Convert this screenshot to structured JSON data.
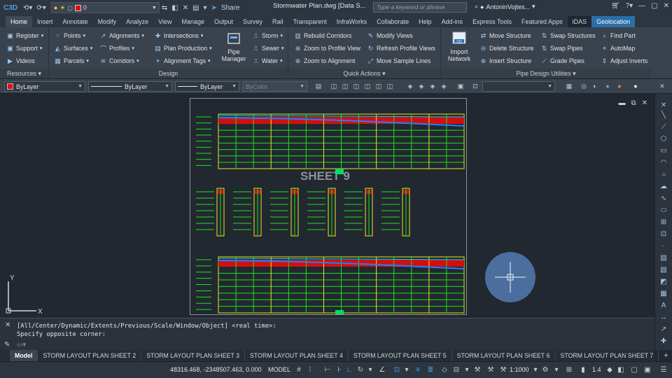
{
  "app": {
    "logo": "C3D",
    "document_title": "Stormwater Plan.dwg [Data S...",
    "search_placeholder": "Type a keyword or phrase",
    "user": "AntoninVojtes...",
    "share": "Share",
    "current_layer": "0"
  },
  "tabs": [
    "Home",
    "Insert",
    "Annotate",
    "Modify",
    "Analyze",
    "View",
    "Manage",
    "Output",
    "Survey",
    "Rail",
    "Transparent",
    "InfraWorks",
    "Collaborate",
    "Help",
    "Add-ins",
    "Express Tools",
    "Featured Apps",
    "iDAS",
    "Geolocation"
  ],
  "ribbon": {
    "left_col": [
      "Register",
      "Support",
      "Videos"
    ],
    "resources_title": "Resources",
    "design_col1": [
      "Points",
      "Surfaces",
      "Parcels"
    ],
    "design_col2": [
      "Alignments",
      "Profiles",
      "Corridors"
    ],
    "design_col3": [
      "Intersections",
      "Plan Production",
      "Alignment Tags"
    ],
    "pipe_manager": [
      "Pipe",
      "Manager"
    ],
    "design_col4": [
      "Storm",
      "Sewer",
      "Water"
    ],
    "design_title": "Design",
    "qa_col1": [
      "Rebuild Corridors",
      "Zoom to Profile View",
      "Zoom to Alignment"
    ],
    "qa_col2": [
      "Modify Views",
      "Refresh Profile Views",
      "Move Sample Lines"
    ],
    "quick_actions_title": "Quick Actions",
    "import_network": [
      "Import",
      "Network"
    ],
    "pdu_col1": [
      "Move Structure",
      "Delete Structure",
      "Insert Structure"
    ],
    "pdu_col2": [
      "Swap Structures",
      "Swap Pipes",
      "Grade Pipes"
    ],
    "pdu_col3": [
      "Find Part",
      "AutoMap",
      "Adjust Inverts"
    ],
    "pipe_design_title": "Pipe Design Utilities"
  },
  "properties": {
    "color": "ByLayer",
    "linetype": "ByLayer",
    "lineweight": "ByLayer",
    "plotstyle": "ByColor",
    "view_combo": ""
  },
  "drawing": {
    "sheet_label": "SHEET 9"
  },
  "command": {
    "line1": "[All/Center/Dynamic/Extents/Previous/Scale/Window/Object] <real time>:",
    "line2": "Specify opposite corner:"
  },
  "layout_tabs": [
    "Model",
    "STORM LAYOUT PLAN SHEET 2",
    "STORM LAYOUT PLAN SHEET 3",
    "STORM LAYOUT PLAN SHEET 4",
    "STORM LAYOUT PLAN SHEET 5",
    "STORM LAYOUT PLAN SHEET 6",
    "STORM LAYOUT PLAN SHEET 7"
  ],
  "status": {
    "coordinates": "48316.468, -2348507.463, 0.000",
    "model": "MODEL",
    "scale": "1:1000",
    "zoom_value": "1.4"
  },
  "colors": {
    "accent": "#2b6ea8",
    "grid_green": "#1ee01e",
    "grid_yellow": "#e8e820",
    "band_red": "#d01010",
    "band_blue": "#2080ff"
  },
  "icons": [
    "undo-icon",
    "redo-icon",
    "bulb-icon",
    "sun-icon",
    "lock-icon",
    "layer-icon",
    "share-icon",
    "search-icon",
    "user-icon",
    "cart-icon",
    "help-icon",
    "minimize-icon",
    "maximize-icon",
    "close-icon"
  ]
}
